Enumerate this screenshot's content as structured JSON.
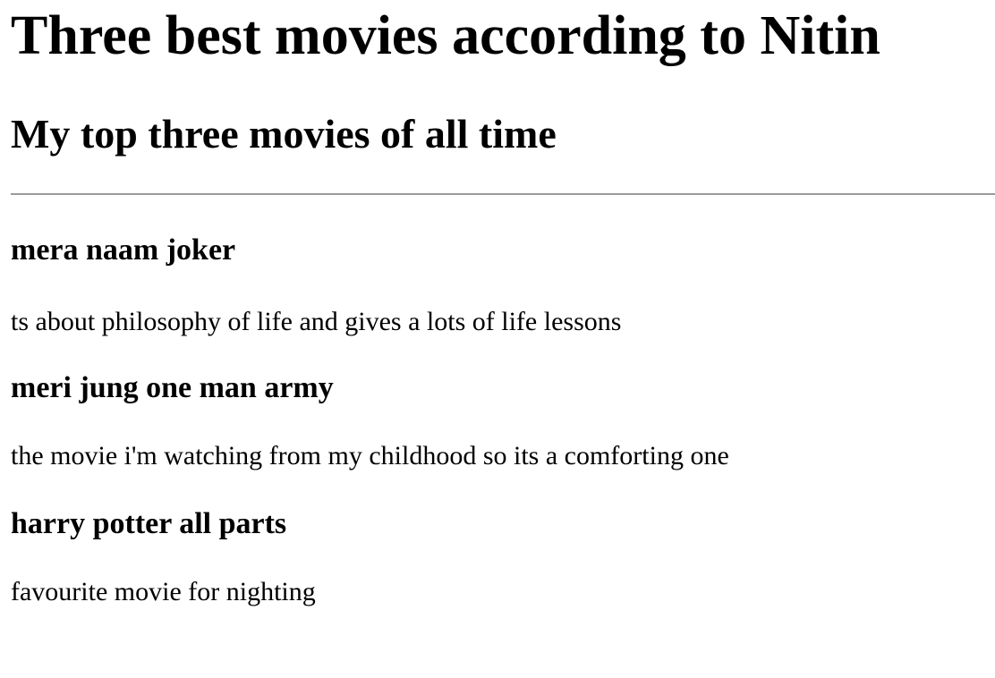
{
  "page": {
    "title": "Three best movies according to Nitin",
    "subtitle": "My top three movies of all time"
  },
  "movies": [
    {
      "name": "mera naam joker",
      "description": "ts about philosophy of life and gives a lots of life lessons"
    },
    {
      "name": "meri jung one man army",
      "description": "the movie i'm watching from my childhood so its a comforting one"
    },
    {
      "name": "harry potter all parts",
      "description": "favourite movie for nighting"
    }
  ]
}
